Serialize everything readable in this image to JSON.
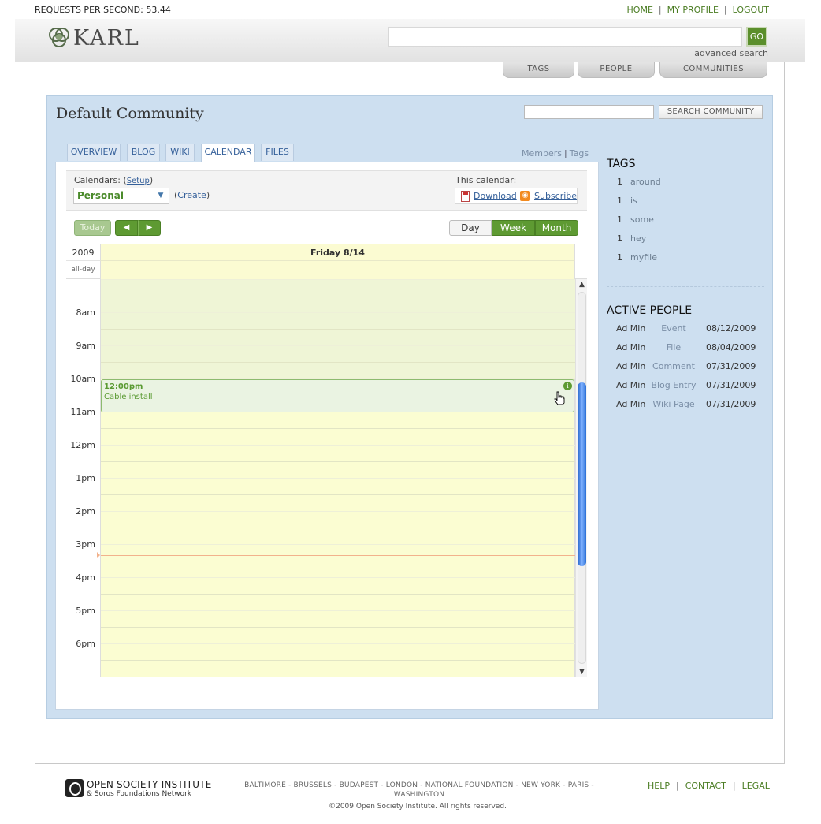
{
  "topbar": {
    "rps_label": "REQUESTS PER SECOND: 53.44",
    "nav": [
      "HOME",
      "MY PROFILE",
      "LOGOUT"
    ]
  },
  "header": {
    "logo_text": "KARL",
    "search_value": "",
    "go_label": "GO",
    "advanced_search": "advanced search",
    "tabs": [
      "TAGS",
      "PEOPLE",
      "COMMUNITIES"
    ]
  },
  "community": {
    "title": "Default Community",
    "search_value": "",
    "search_button": "SEARCH COMMUNITY",
    "tabs": [
      "OVERVIEW",
      "BLOG",
      "WIKI",
      "CALENDAR",
      "FILES"
    ],
    "active_tab": "CALENDAR",
    "members": "Members",
    "tags": "Tags"
  },
  "calendar_toolbar": {
    "calendars_label": "Calendars:",
    "setup": "Setup",
    "selected_calendar": "Personal",
    "create": "Create",
    "this_calendar": "This calendar:",
    "download": "Download",
    "subscribe": "Subscribe",
    "today": "Today",
    "views": [
      "Day",
      "Week",
      "Month"
    ],
    "active_view": "Day"
  },
  "calendar_grid": {
    "year": "2009",
    "allday": "all-day",
    "day_heading": "Friday 8/14",
    "hours": [
      "8am",
      "9am",
      "10am",
      "11am",
      "12pm",
      "1pm",
      "2pm",
      "3pm",
      "4pm",
      "5pm",
      "6pm"
    ],
    "event": {
      "time": "12:00pm",
      "title": "Cable install",
      "info_glyph": "i"
    }
  },
  "tags": {
    "title": "TAGS",
    "items": [
      {
        "count": "1",
        "name": "around"
      },
      {
        "count": "1",
        "name": "is"
      },
      {
        "count": "1",
        "name": "some"
      },
      {
        "count": "1",
        "name": "hey"
      },
      {
        "count": "1",
        "name": "myfile"
      }
    ]
  },
  "active_people": {
    "title": "ACTIVE PEOPLE",
    "rows": [
      {
        "name": "Ad Min",
        "type": "Event",
        "date": "08/12/2009"
      },
      {
        "name": "Ad Min",
        "type": "File",
        "date": "08/04/2009"
      },
      {
        "name": "Ad Min",
        "type": "Comment",
        "date": "07/31/2009"
      },
      {
        "name": "Ad Min",
        "type": "Blog Entry",
        "date": "07/31/2009"
      },
      {
        "name": "Ad Min",
        "type": "Wiki Page",
        "date": "07/31/2009"
      }
    ]
  },
  "footer": {
    "org_name": "OPEN SOCIETY INSTITUTE",
    "org_sub": "& Soros Foundations Network",
    "cities": "BALTIMORE - BRUSSELS - BUDAPEST - LONDON - NATIONAL FOUNDATION - NEW YORK - PARIS - WASHINGTON",
    "links": [
      "HELP",
      "CONTACT",
      "LEGAL"
    ],
    "copyright": "©2009 Open Society Institute. All rights reserved."
  },
  "colors": {
    "accent_green": "#5e9a32",
    "link_blue": "#35609a",
    "community_bg": "#cddff0",
    "day_bg": "#fbfdd2"
  }
}
